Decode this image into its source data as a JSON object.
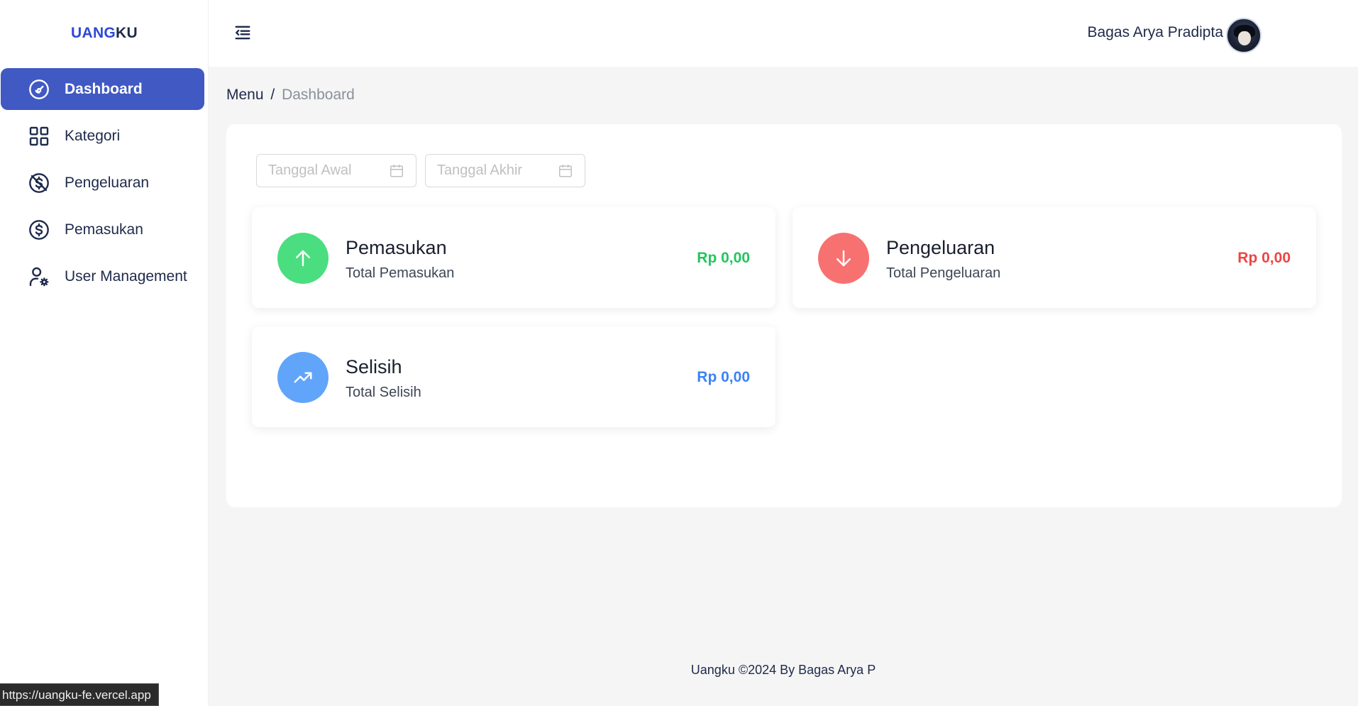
{
  "brand": {
    "part1": "UANG",
    "part2": "KU",
    "color_primary": "#2f49d1",
    "color_secondary": "#1e2a4a"
  },
  "sidebar": {
    "items": [
      {
        "label": "Dashboard",
        "icon": "dashboard-gauge-icon",
        "active": true
      },
      {
        "label": "Kategori",
        "icon": "category-grid-icon",
        "active": false
      },
      {
        "label": "Pengeluaran",
        "icon": "no-money-icon",
        "active": false
      },
      {
        "label": "Pemasukan",
        "icon": "dollar-circle-icon",
        "active": false
      },
      {
        "label": "User Management",
        "icon": "user-settings-icon",
        "active": false
      }
    ],
    "active_color": "#4059c3"
  },
  "header": {
    "user_name": "Bagas Arya Pradipta",
    "menu_icon": "menu-collapse-icon"
  },
  "breadcrumb": {
    "menu": "Menu",
    "separator": "/",
    "current": "Dashboard"
  },
  "filters": {
    "start_placeholder": "Tanggal Awal",
    "end_placeholder": "Tanggal Akhir",
    "icon": "calendar-icon"
  },
  "cards": {
    "income": {
      "title": "Pemasukan",
      "subtitle": "Total Pemasukan",
      "value": "Rp 0,00",
      "color": "#22c55e",
      "circle_color": "#4ade80",
      "icon": "arrow-up-icon"
    },
    "expense": {
      "title": "Pengeluaran",
      "subtitle": "Total Pengeluaran",
      "value": "Rp 0,00",
      "color": "#ef4444",
      "circle_color": "#f87171",
      "icon": "arrow-down-icon"
    },
    "difference": {
      "title": "Selisih",
      "subtitle": "Total Selisih",
      "value": "Rp 0,00",
      "color": "#3b82f6",
      "circle_color": "#60a5fa",
      "icon": "trending-up-icon"
    }
  },
  "footer": {
    "text": "Uangku ©2024 By Bagas Arya P"
  },
  "status_bar": {
    "url": "https://uangku-fe.vercel.app"
  }
}
